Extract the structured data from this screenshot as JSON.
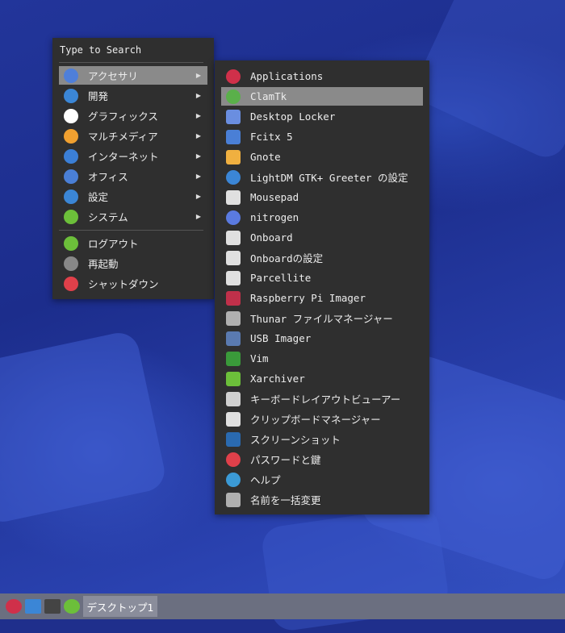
{
  "main_menu": {
    "search_label": "Type to Search",
    "categories": [
      {
        "label": "アクセサリ",
        "icon": "accessories-icon",
        "color": "#4f7fd9"
      },
      {
        "label": "開発",
        "icon": "development-icon",
        "color": "#3b86d6"
      },
      {
        "label": "グラフィックス",
        "icon": "graphics-icon",
        "color": "#ffffff"
      },
      {
        "label": "マルチメディア",
        "icon": "multimedia-icon",
        "color": "#f0a030"
      },
      {
        "label": "インターネット",
        "icon": "internet-icon",
        "color": "#3b7fd6"
      },
      {
        "label": "オフィス",
        "icon": "office-icon",
        "color": "#4a7fd6"
      },
      {
        "label": "設定",
        "icon": "settings-icon",
        "color": "#3b86d6"
      },
      {
        "label": "システム",
        "icon": "system-icon",
        "color": "#6cbf3a"
      }
    ],
    "actions": [
      {
        "label": "ログアウト",
        "icon": "logout-icon",
        "color": "#6cbf3a"
      },
      {
        "label": "再起動",
        "icon": "restart-icon",
        "color": "#888888"
      },
      {
        "label": "シャットダウン",
        "icon": "shutdown-icon",
        "color": "#e0404a"
      }
    ],
    "arrow_glyph": "▶"
  },
  "sub_menu": {
    "items": [
      {
        "label": "Applications",
        "icon": "applications-icon",
        "color": "#d0304a"
      },
      {
        "label": "ClamTk",
        "icon": "clamtk-icon",
        "color": "#5ab04a"
      },
      {
        "label": "Desktop Locker",
        "icon": "desktop-locker-icon",
        "color": "#6a8ee0"
      },
      {
        "label": "Fcitx 5",
        "icon": "fcitx-icon",
        "color": "#4a7fd6"
      },
      {
        "label": "Gnote",
        "icon": "gnote-icon",
        "color": "#f0b040"
      },
      {
        "label": "LightDM GTK+ Greeter の設定",
        "icon": "lightdm-icon",
        "color": "#3b86d6"
      },
      {
        "label": "Mousepad",
        "icon": "mousepad-icon",
        "color": "#e0e0e0"
      },
      {
        "label": "nitrogen",
        "icon": "nitrogen-icon",
        "color": "#5a7ae0"
      },
      {
        "label": "Onboard",
        "icon": "onboard-icon",
        "color": "#e0e0e0"
      },
      {
        "label": "Onboardの設定",
        "icon": "onboard-settings-icon",
        "color": "#e0e0e0"
      },
      {
        "label": "Parcellite",
        "icon": "parcellite-icon",
        "color": "#e0e0e0"
      },
      {
        "label": "Raspberry Pi Imager",
        "icon": "raspberry-pi-imager-icon",
        "color": "#c0304a"
      },
      {
        "label": "Thunar ファイルマネージャー",
        "icon": "thunar-icon",
        "color": "#b0b0b0"
      },
      {
        "label": "USB Imager",
        "icon": "usb-imager-icon",
        "color": "#5a7ab0"
      },
      {
        "label": "Vim",
        "icon": "vim-icon",
        "color": "#3a9a3a"
      },
      {
        "label": "Xarchiver",
        "icon": "xarchiver-icon",
        "color": "#6cbf3a"
      },
      {
        "label": "キーボードレイアウトビューアー",
        "icon": "keyboard-icon",
        "color": "#d0d0d0"
      },
      {
        "label": "クリップボードマネージャー",
        "icon": "clipboard-icon",
        "color": "#e0e0e0"
      },
      {
        "label": "スクリーンショット",
        "icon": "screenshot-icon",
        "color": "#2a6ab0"
      },
      {
        "label": "パスワードと鍵",
        "icon": "passwords-icon",
        "color": "#e0404a"
      },
      {
        "label": "ヘルプ",
        "icon": "help-icon",
        "color": "#3b9ad6"
      },
      {
        "label": "名前を一括変更",
        "icon": "bulk-rename-icon",
        "color": "#b0b0b0"
      }
    ]
  },
  "taskbar": {
    "task_label": "デスクトップ1",
    "icons": [
      {
        "name": "menu-launcher-icon",
        "color": "#d0304a"
      },
      {
        "name": "file-manager-icon",
        "color": "#3b86d6"
      },
      {
        "name": "terminal-icon",
        "color": "#444444"
      },
      {
        "name": "settings-launcher-icon",
        "color": "#6cbf3a"
      }
    ]
  },
  "colors": {
    "menu_bg": "#2f2f2f",
    "selection": "#8a8a8a",
    "taskbar": "#6b6f80",
    "desktop": "#1f2f8c"
  }
}
